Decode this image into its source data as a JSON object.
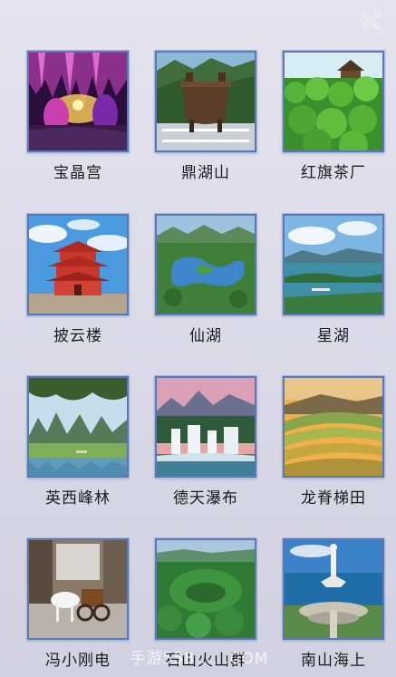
{
  "close_button": {
    "icon": "close-icon",
    "color": "#f4f2f8"
  },
  "spots": [
    {
      "id": "baojinggong",
      "label": "宝晶宫"
    },
    {
      "id": "dinghushan",
      "label": "鼎湖山"
    },
    {
      "id": "hongqichachang",
      "label": "红旗茶厂"
    },
    {
      "id": "piyunlou",
      "label": "披云楼"
    },
    {
      "id": "xianhu",
      "label": "仙湖"
    },
    {
      "id": "xinghu",
      "label": "星湖"
    },
    {
      "id": "yingxifenglin",
      "label": "英西峰林"
    },
    {
      "id": "detianpubu",
      "label": "德天瀑布"
    },
    {
      "id": "longjitian",
      "label": "龙脊梯田"
    },
    {
      "id": "fengxiaogangdianying",
      "label": "冯小刚电"
    },
    {
      "id": "shishanhuoshanqun",
      "label": "石山火山群"
    },
    {
      "id": "nanshanhaishang",
      "label": "南山海上"
    }
  ],
  "watermark": "手游558 ... .COM"
}
